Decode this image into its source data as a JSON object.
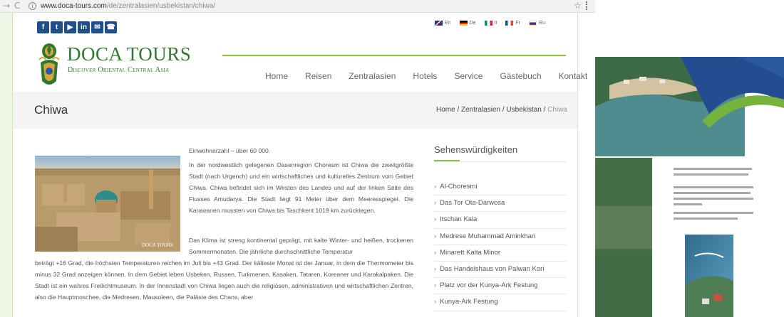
{
  "browser": {
    "url_host": "www.doca-tours.com",
    "url_path": "/de/zentralasien/usbekistan/chiwa/"
  },
  "header": {
    "social_icons": [
      "facebook-icon",
      "twitter-icon",
      "youtube-icon",
      "linkedin-icon",
      "mail-icon",
      "phone-icon"
    ],
    "languages": [
      {
        "code": "En",
        "colors": [
          "#1f3b8c",
          "#c8102e"
        ]
      },
      {
        "code": "De",
        "colors": [
          "#000000",
          "#dd0000",
          "#ffce00"
        ]
      },
      {
        "code": "It",
        "colors": [
          "#009246",
          "#ffffff",
          "#ce2b37"
        ]
      },
      {
        "code": "Fr",
        "colors": [
          "#0055a4",
          "#ffffff",
          "#ef4135"
        ]
      },
      {
        "code": "Ru",
        "colors": [
          "#ffffff",
          "#0039a6",
          "#d52b1e"
        ]
      }
    ],
    "logo_title": "DOCA TOURS",
    "logo_subtitle": "Discover Oriental Central Asia",
    "menu": [
      "Home",
      "Reisen",
      "Zentralasien",
      "Hotels",
      "Service",
      "Gästebuch",
      "Kontakt"
    ]
  },
  "titlebar": {
    "title": "Chiwa",
    "breadcrumb": [
      "Home",
      "Zentralasien",
      "Usbekistan",
      "Chiwa"
    ]
  },
  "content": {
    "image_caption": "DOCA TOURS",
    "population": "Einwohnerzahl – über 60 000.",
    "paragraph1": "In der nordwestlich gelegenen Oasenregion Choresm ist Chiwa die zweitgrößte Stadt (nach Urgench) und ein wirtschaftliches und kulturelles Zentrum vom Gebiet Chiwa. Chiwa befindet sich im Westen des Landes und auf der linken Seite des Flusses Amudarya. Die Stadt liegt 91 Meter über dem Meeresspiegel. Die Karawanen mussten von Chiwa bis Taschkent 1019 km zurücklegen.",
    "paragraph2a": "Das Klima ist streng kontinental geprägt, mit kalte Winter- und heißen, trockenen Sommermonaten. Die jährliche durchschnittliche Temperatur",
    "paragraph2b": "beträgt +16 Grad, die höchsten Temperaturen reichen im Juli bis +43 Grad. Der kälteste Monat ist der Januar, in dem die Thermometer bis minus 32 Grad anzeigen können. In dem Gebiet leben Usbeken, Russen, Turkmenen, Kasaken, Tataren, Koreaner und Karakalpaken. Die Stadt ist ein wahres Freilichtmuseum. In der Innenstadt von Chiwa liegen auch die religiösen, administrativen und wirtschaftlichen Zentren, also die Hauptmoschee, die Medresen, Mausoleen, die Paläste des Chans, aber"
  },
  "sidebar": {
    "title": "Sehenswürdigkeiten",
    "items": [
      "Al-Choresmi",
      "Das Tor Ota-Darwosa",
      "Itschan Kala",
      "Medrese Muhammad Aminkhan",
      "Minarett Kalta Minor",
      "Das Handelshaus von Palwan Kori",
      "Platz vor der Kunya-Ark Festung",
      "Kunya-Ark Festung"
    ]
  },
  "colors": {
    "brand_green": "#2f7a2c",
    "accent_green": "#8cc63e",
    "social_blue": "#1f4e8c"
  }
}
